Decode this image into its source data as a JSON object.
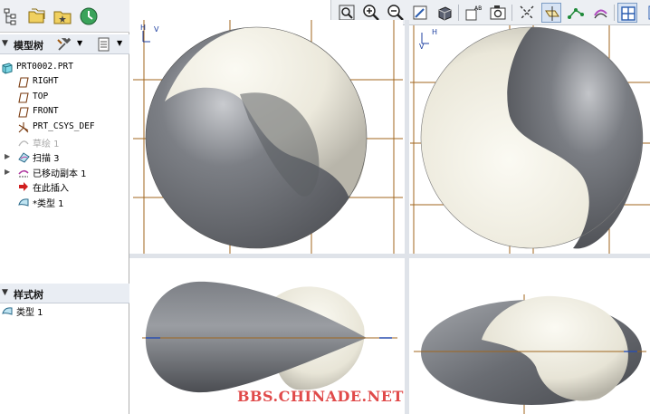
{
  "model_tree": {
    "title": "模型树",
    "items": [
      {
        "label": "PRT0002.PRT",
        "icon": "part-icon",
        "mono": true,
        "indent": 0
      },
      {
        "label": "RIGHT",
        "icon": "datum-plane-icon",
        "mono": true,
        "indent": 1
      },
      {
        "label": "TOP",
        "icon": "datum-plane-icon",
        "mono": true,
        "indent": 1
      },
      {
        "label": "FRONT",
        "icon": "datum-plane-icon",
        "mono": true,
        "indent": 1
      },
      {
        "label": "PRT_CSYS_DEF",
        "icon": "csys-icon",
        "mono": true,
        "indent": 1
      },
      {
        "label": "草绘 1",
        "icon": "sketch-icon",
        "mono": false,
        "indent": 1,
        "dimmed": true
      },
      {
        "label": "扫描 3",
        "icon": "sweep-icon",
        "mono": false,
        "indent": 1,
        "expandable": true
      },
      {
        "label": "已移动副本 1",
        "icon": "moved-copy-icon",
        "mono": false,
        "indent": 1,
        "expandable": true
      },
      {
        "label": "在此插入",
        "icon": "insert-here-icon",
        "mono": false,
        "indent": 1
      },
      {
        "label": "类型 1",
        "icon": "style-type-icon",
        "mono": false,
        "indent": 1,
        "prefix": "*"
      }
    ]
  },
  "style_tree": {
    "title": "样式树",
    "items": [
      {
        "label": "类型 1",
        "icon": "style-type-icon"
      }
    ]
  },
  "viewports": {
    "top_left": {
      "axis_label": "H",
      "axis_label2": "V"
    },
    "top_right": {
      "axis_label": "H",
      "axis_label2": "V"
    }
  },
  "watermark": "BBS.CHINADE.NET",
  "colors": {
    "grid_line": "#a0661e",
    "watermark": "#e04a4a",
    "panel_header": "#e9edf3"
  }
}
